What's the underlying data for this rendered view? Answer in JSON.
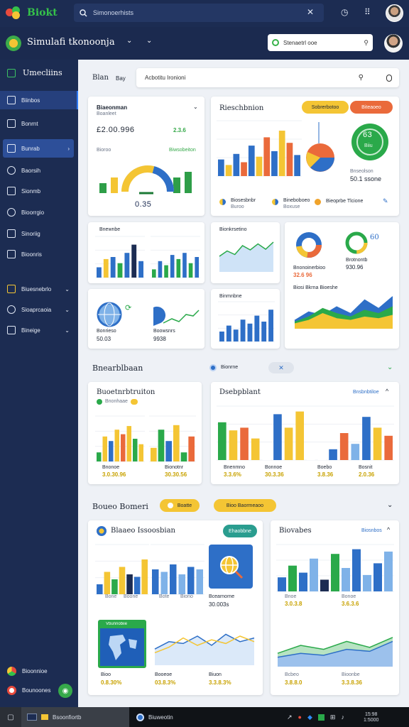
{
  "topbar": {
    "brand": "Biokt",
    "search_text": "Simonoerhists",
    "icons": [
      "leaf-logo",
      "search-icon",
      "close-icon",
      "clock-icon",
      "grid-icon",
      "avatar"
    ]
  },
  "appbar": {
    "title": "Simulafi tkonoonja",
    "search_text": "Stenaetrl ooe",
    "colors": {
      "bar": "#1b2a4f",
      "brand": "#35c24a"
    }
  },
  "sidebar": {
    "header": "Umecliins",
    "items": [
      {
        "label": "Biinbos"
      },
      {
        "label": "Bonrnt"
      },
      {
        "label": "Bunrab"
      },
      {
        "label": "Baorsih"
      },
      {
        "label": "Sionmb"
      },
      {
        "label": "Bioorrgio"
      },
      {
        "label": "Sinoriig"
      },
      {
        "label": "Bioonris"
      },
      {
        "label": "Biuesnebrlo"
      },
      {
        "label": "Sioaprcaoia"
      },
      {
        "label": "Bineige"
      }
    ],
    "footer": [
      "Bioonnioe",
      "Bounoones"
    ]
  },
  "toolbar": {
    "left": "Blan",
    "left2": "Bay",
    "search_placeholder": "Acbotitu Ironioni"
  },
  "cards": {
    "gauge": {
      "title": "Biaeonman",
      "subtitle": "Boanleet",
      "value": "£2.00.996",
      "badge": "2.3.6",
      "legend1": "Bioroo",
      "legend2": "Biwsobeiton",
      "gauge_value": "0.35"
    },
    "budget": {
      "title": "Rieschbnion",
      "btn1": "Sobrerbotoo",
      "btn2": "Biteaoeo",
      "donut_value": "63",
      "donut_sub": "Biiu",
      "kpi_label": "Bnseolson",
      "kpi_value": "50.1 ssone",
      "legend": [
        "Biosesbnbr",
        "Bineboboeo",
        "Bieoprbe Tlcione"
      ],
      "legend_sub": [
        "Buroo",
        "Boxuse"
      ]
    },
    "mini1": {
      "title": "Bnewnbe"
    },
    "mini2": {
      "title": "Bionkrsetino"
    },
    "mini3": {
      "title": "Bonrieso",
      "value": "50.03"
    },
    "mini4": {
      "title": "Boowsnrs",
      "value": "9938"
    },
    "mini5": {
      "title": "Binmnbne"
    },
    "mini6": {
      "title": "Bnesnsbe"
    },
    "donuts": {
      "d1_label": "Bnonoinerbioo",
      "d1_value": "32.6 96",
      "d2_label": "Brotnontb",
      "d2_value": "930.96",
      "d2_num": "60"
    },
    "area": {
      "title": "Biosi Bkrna Bioeshe"
    }
  },
  "section2": {
    "title": "Bnearblbaan",
    "filter": "Bionrne",
    "left": {
      "title": "Buoetnrbtruiton",
      "tag": "Bnonhaae",
      "labels": [
        "Bnonoe",
        "Bionotnr"
      ],
      "values": [
        "3.0.30.96",
        "30.30.56"
      ]
    },
    "right": {
      "title": "Dsebpblant",
      "link": "Bnsbnbtiloe",
      "labels": [
        "Bnenmno",
        "Bonnoe",
        "Boebo",
        "Bosnit"
      ],
      "values": [
        "3.3.6%",
        "30.3.36",
        "3.8.36",
        "2.0.36"
      ]
    }
  },
  "section3": {
    "title": "Boueo Bomeri",
    "btn1": "Boatte",
    "btn2": "Bioo Baormeaoo",
    "left": {
      "title": "Blaaeo Issoosbian",
      "tag": "Ehaobbne",
      "tile_label": "Bcearnorne",
      "tile_value": "30.003s",
      "mini_labels": [
        "Bone",
        "Boone",
        "Bote",
        "Biono"
      ],
      "bottom_labels": [
        "Bioo",
        "Booeoe",
        "Biuon"
      ],
      "bottom_values": [
        "0.8.30%",
        "03.8.3%",
        "3.3.8.3%"
      ],
      "map_title": "Vbunnobiie"
    },
    "right": {
      "title": "Biovabes",
      "link": "Biosnbos",
      "bar_labels": [
        "Bnoe",
        "Bonoe"
      ],
      "bar_values": [
        "3.0.3.8",
        "3.6.3.6"
      ],
      "area_labels": [
        "Bcbeo",
        "Bioonbe"
      ],
      "area_values": [
        "3.8.8.0",
        "3.3.8.36"
      ]
    }
  },
  "taskbar": {
    "app1": "Bsoonfiortb",
    "app2": "Biuweotin",
    "time": "15:98",
    "date": "1:5000"
  },
  "chart_data": [
    {
      "type": "bar",
      "series": [
        {
          "name": "",
          "values": [
            20,
            55,
            45,
            70,
            60,
            78,
            50,
            38
          ]
        }
      ]
    },
    {
      "type": "bar",
      "series": [
        {
          "name": "",
          "values": [
            30,
            55,
            40,
            70,
            25,
            80,
            50,
            90,
            35,
            60,
            85
          ]
        }
      ]
    },
    {
      "type": "line",
      "series": [
        {
          "name": "",
          "values": [
            40,
            55,
            45,
            70,
            58,
            75,
            60,
            80
          ]
        }
      ]
    },
    {
      "type": "area",
      "series": [
        {
          "name": "",
          "values": [
            30,
            50,
            40,
            60,
            45,
            70
          ]
        },
        {
          "name": "",
          "values": [
            20,
            30,
            25,
            40,
            35,
            60
          ]
        }
      ]
    }
  ]
}
